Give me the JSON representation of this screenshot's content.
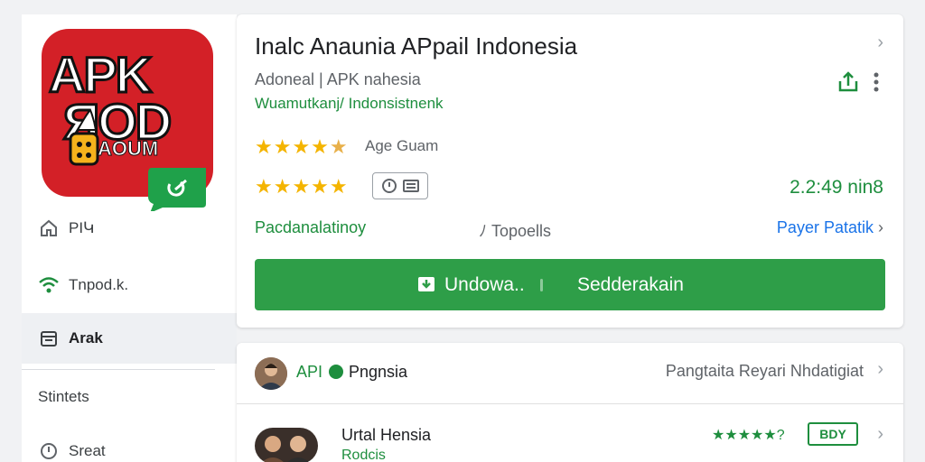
{
  "sidebar": {
    "logo": {
      "line1": "APK",
      "line2": "ЯOD",
      "line3": "AOUM"
    },
    "items": [
      {
        "label": "PIԿ",
        "icon": "home-icon"
      },
      {
        "label": "Tnpod.k.",
        "icon": "wifi-icon"
      },
      {
        "label": "Arak",
        "icon": "calendar-icon",
        "active": true
      }
    ],
    "extra": [
      {
        "label": "Stintets"
      },
      {
        "label": "Sreat",
        "icon": "clock-icon"
      }
    ]
  },
  "app": {
    "title": "Inalc Anaunia APpail Indonesia",
    "subtitle": "Adoneal | APK nahesia",
    "tagline": "Wuamutkanj/ Indonsistnenk",
    "rating_label": "Age Guam",
    "time": "2.2:49 nin8",
    "meta_left": "Pacdanalatinoy",
    "meta_mid": "Topoells",
    "meta_right": "Payer Patatik",
    "download": {
      "primary": "Undowa..",
      "secondary": "Sedderakain"
    }
  },
  "list": [
    {
      "title": "API",
      "badge": "Pngnsia",
      "right_text": "Pangtaita Reyari Nhdatigiat"
    },
    {
      "title": "Urtal Hensia",
      "subtitle": "Rodcis",
      "stars": "★★★★★",
      "rating_suffix": "?",
      "tag": "BDY"
    }
  ],
  "colors": {
    "accent_green": "#2e9e48",
    "link_blue": "#1a73e8",
    "star": "#f4b400",
    "logo_red": "#d32027"
  }
}
